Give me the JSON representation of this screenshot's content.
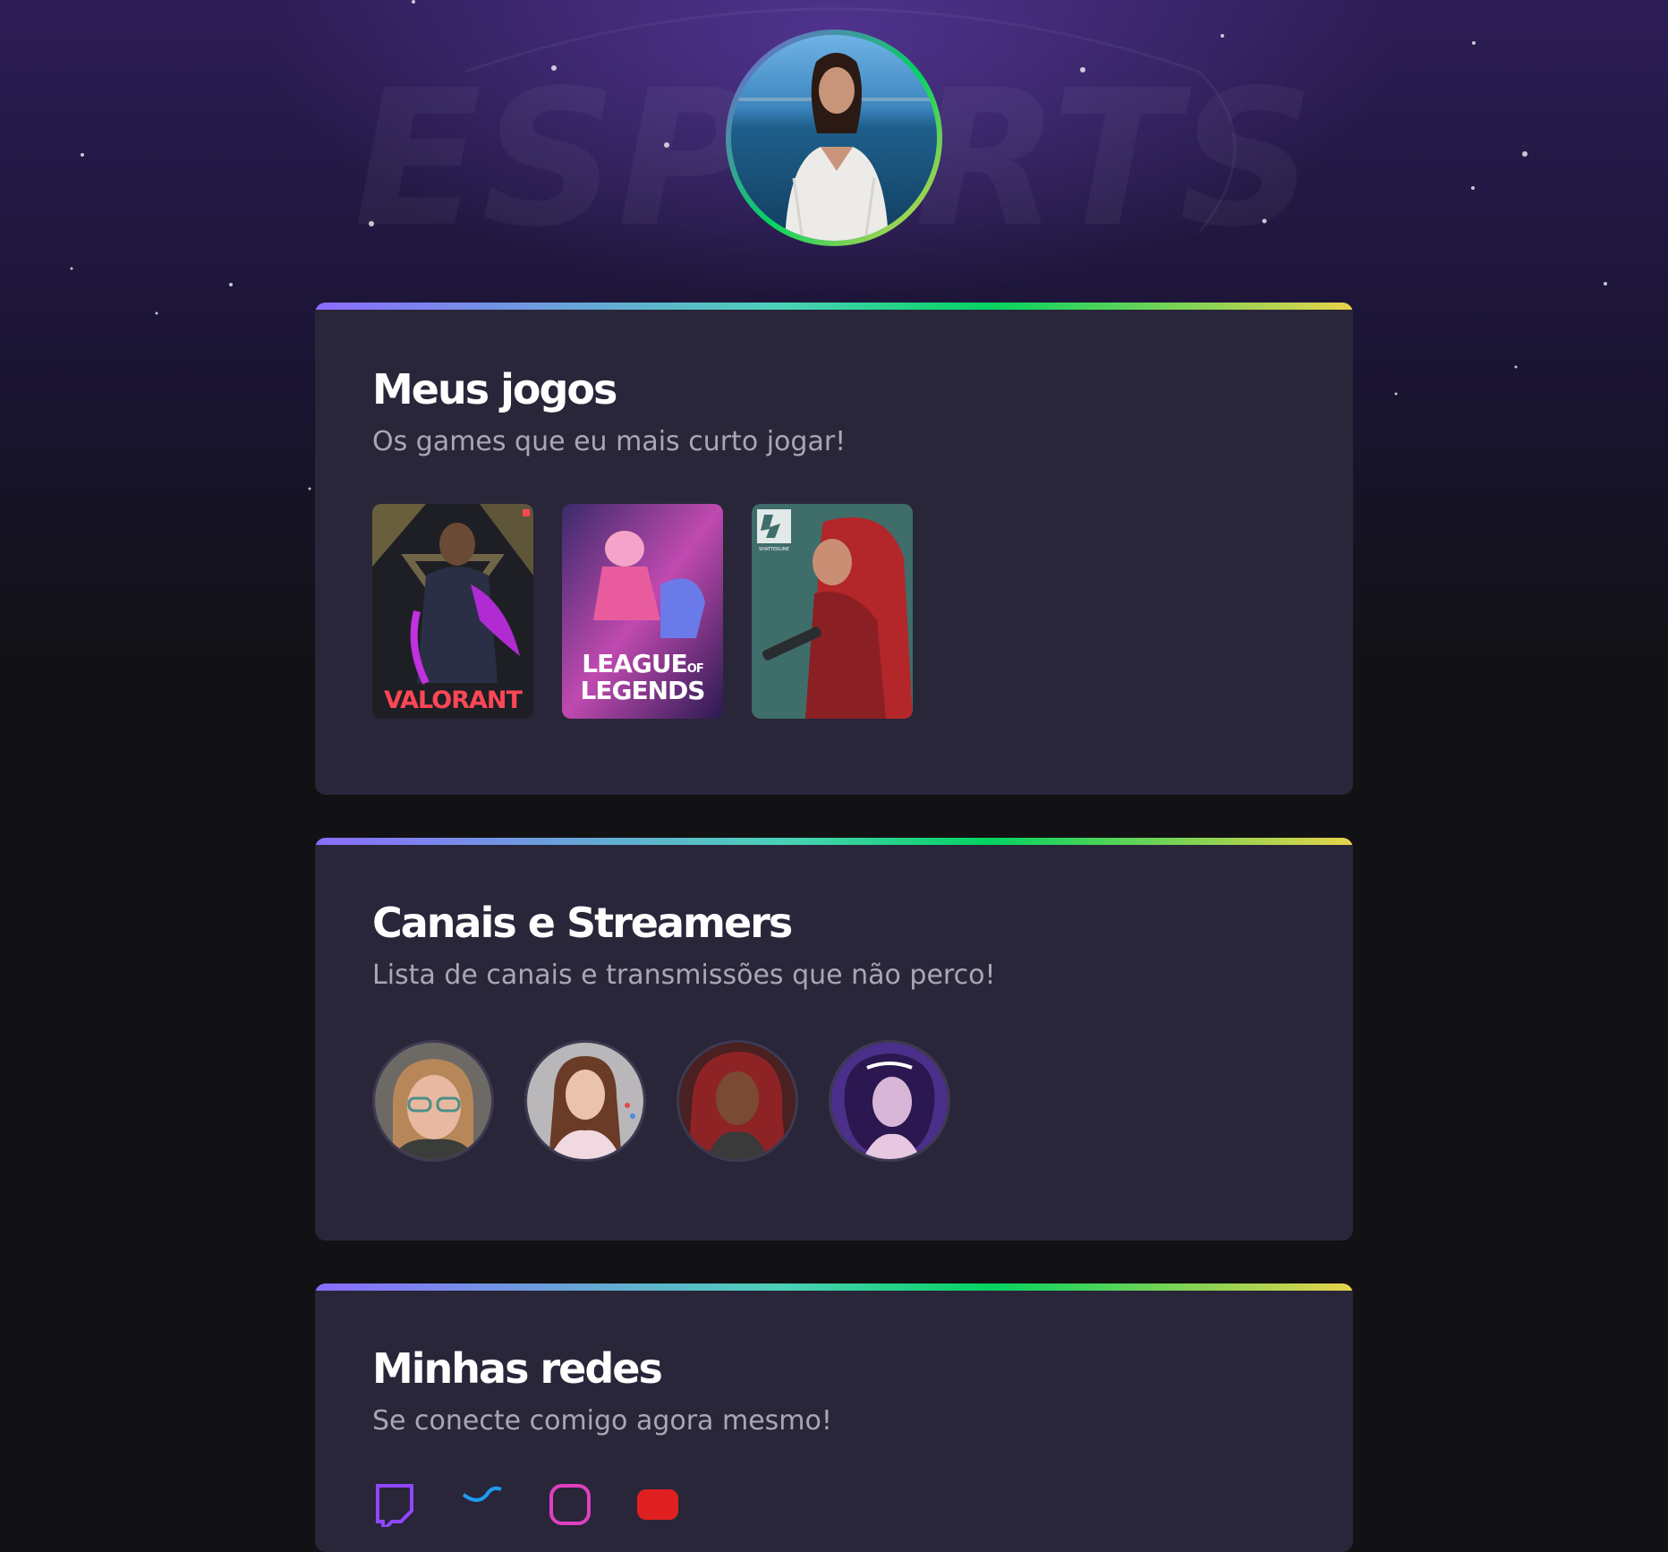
{
  "profile": {
    "avatar": "profile-photo"
  },
  "background": {
    "watermark": "ESPORTS"
  },
  "colors": {
    "accent_purple": "#8257e5",
    "accent_green": "#04d361",
    "accent_yellow": "#e8d34a",
    "card_bg": "#29263a",
    "page_bg": "#121214"
  },
  "games_section": {
    "title": "Meus jogos",
    "subtitle": "Os games que eu mais curto jogar!",
    "games": [
      {
        "name": "VALORANT",
        "art": "valorant-cover"
      },
      {
        "name_line1": "LEAGUE",
        "name_of": "OF",
        "name_line2": "LEGENDS",
        "art": "league-of-legends-cover"
      },
      {
        "logo_text": "SHATTERLINE",
        "art": "shatterline-cover"
      }
    ]
  },
  "streamers_section": {
    "title": "Canais e Streamers",
    "subtitle": "Lista de canais e transmissões que não perco!",
    "streamers": [
      "streamer-1",
      "streamer-2",
      "streamer-3",
      "streamer-4"
    ]
  },
  "social_section": {
    "title": "Minhas redes",
    "subtitle": "Se conecte comigo agora mesmo!",
    "networks": [
      "twitch-icon",
      "twitter-icon",
      "instagram-icon",
      "youtube-icon"
    ]
  }
}
